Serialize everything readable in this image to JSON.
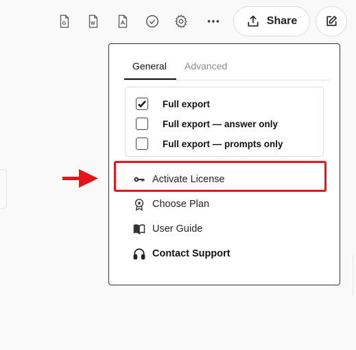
{
  "toolbar": {
    "icons": [
      "google-doc-icon",
      "word-doc-icon",
      "pdf-doc-icon",
      "check-circle-icon",
      "gear-icon",
      "more-horizontal-icon"
    ],
    "share_label": "Share",
    "edit_icon": "edit-icon"
  },
  "menu": {
    "tabs": [
      {
        "label": "General",
        "active": true
      },
      {
        "label": "Advanced",
        "active": false
      }
    ],
    "export_options": [
      {
        "label": "Full export",
        "checked": true
      },
      {
        "label": "Full export — answer only",
        "checked": false
      },
      {
        "label": "Full export — prompts only",
        "checked": false
      }
    ],
    "items": [
      {
        "label": "Activate License",
        "icon": "key-icon"
      },
      {
        "label": "Choose Plan",
        "icon": "badge-icon"
      },
      {
        "label": "User Guide",
        "icon": "book-icon"
      },
      {
        "label": "Contact Support",
        "icon": "headphones-icon"
      }
    ]
  },
  "annotation": {
    "arrow_color": "#e8141b",
    "highlight_color": "#e8141b"
  }
}
